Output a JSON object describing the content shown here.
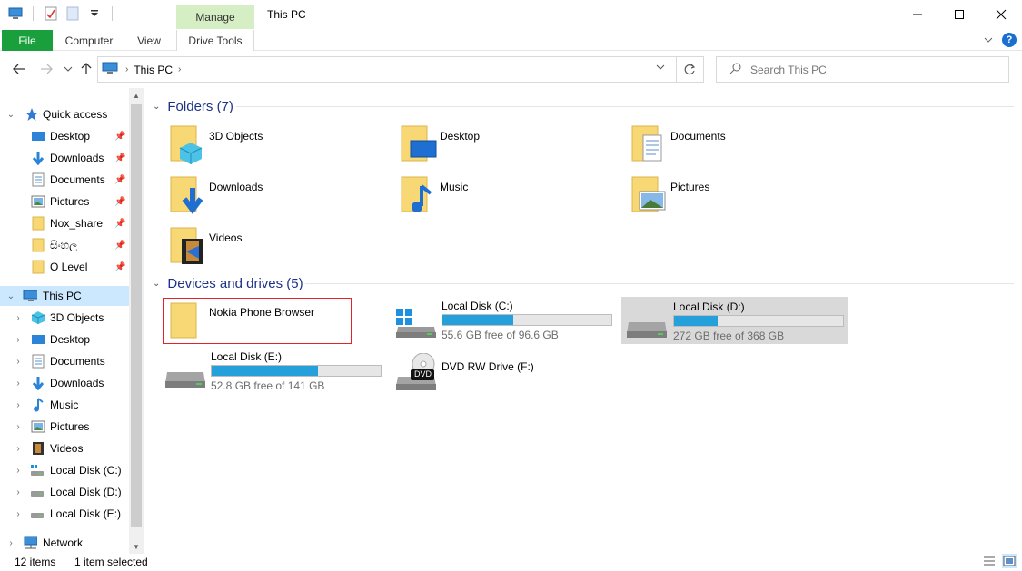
{
  "window": {
    "title": "This PC",
    "context_tab": "Manage"
  },
  "ribbon": {
    "file": "File",
    "computer": "Computer",
    "view": "View",
    "drive_tools": "Drive Tools"
  },
  "address": {
    "crumb": "This PC",
    "search_placeholder": "Search This PC"
  },
  "sidebar": {
    "quick_access": "Quick access",
    "quick_items": [
      "Desktop",
      "Downloads",
      "Documents",
      "Pictures",
      "Nox_share",
      "සිංහල",
      "O Level"
    ],
    "this_pc": "This PC",
    "pc_items": [
      "3D Objects",
      "Desktop",
      "Documents",
      "Downloads",
      "Music",
      "Pictures",
      "Videos",
      "Local Disk (C:)",
      "Local Disk (D:)",
      "Local Disk (E:)"
    ],
    "network": "Network"
  },
  "folders": {
    "header": "Folders (7)",
    "items": [
      "3D Objects",
      "Desktop",
      "Documents",
      "Downloads",
      "Music",
      "Pictures",
      "Videos"
    ]
  },
  "devices": {
    "header": "Devices and drives (5)",
    "phone": "Nokia Phone Browser",
    "drives": [
      {
        "name": "Local Disk (C:)",
        "free": "55.6 GB free of 96.6 GB",
        "used_fraction": 0.42
      },
      {
        "name": "Local Disk (D:)",
        "free": "272 GB free of 368 GB",
        "used_fraction": 0.26
      },
      {
        "name": "Local Disk (E:)",
        "free": "52.8 GB free of 141 GB",
        "used_fraction": 0.63
      }
    ],
    "dvd": "DVD RW Drive (F:)",
    "dvd_badge": "DVD"
  },
  "status": {
    "items": "12 items",
    "selected": "1 item selected"
  },
  "colors": {
    "accent_file_tab": "#19a03c",
    "context_tab": "#d6eec4",
    "selection": "#cce8ff",
    "drive_bar": "#26a0da",
    "highlight_box": "#e0242a",
    "group_header": "#1e3287"
  }
}
